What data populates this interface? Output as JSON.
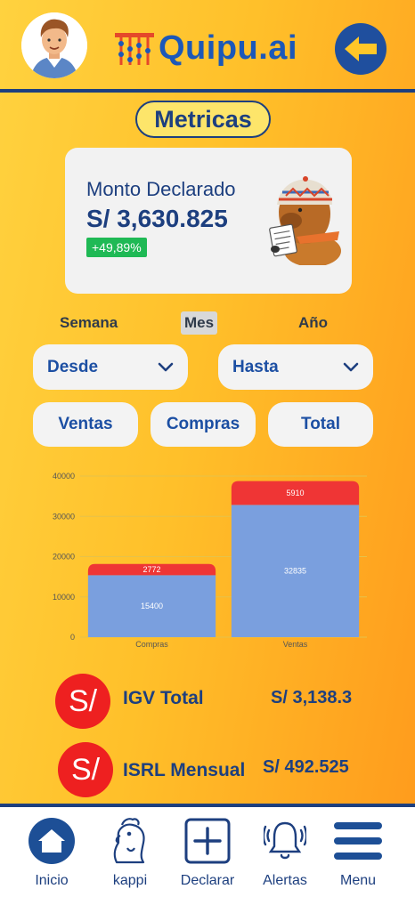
{
  "header": {
    "logo_text": "Quipu.ai",
    "avatar_icon": "user-avatar",
    "back_icon": "arrow-left-icon"
  },
  "page_title": "Metricas",
  "summary_card": {
    "label": "Monto Declarado",
    "amount": "S/ 3,630.825",
    "change": "+49,89%"
  },
  "periods": [
    "Semana",
    "Mes",
    "Año"
  ],
  "active_period": "Mes",
  "filters": {
    "from_label": "Desde",
    "to_label": "Hasta"
  },
  "segments": [
    "Ventas",
    "Compras",
    "Total"
  ],
  "chart_data": {
    "type": "bar",
    "stacked": true,
    "categories": [
      "Compras",
      "Ventas"
    ],
    "series": [
      {
        "values": [
          15400,
          32835
        ],
        "color": "#7a9fde"
      },
      {
        "values": [
          2772,
          5910
        ],
        "color": "#ef3535"
      }
    ],
    "ylim": [
      0,
      40000
    ],
    "yticks": [
      "0",
      "10000",
      "20000",
      "30000",
      "40000"
    ],
    "grid": true
  },
  "stats": [
    {
      "icon_text": "S/",
      "label": "IGV Total",
      "value": "S/ 3,138.3"
    },
    {
      "icon_text": "S/",
      "label": "ISRL Mensual",
      "value": "S/ 492.525"
    }
  ],
  "nav": [
    {
      "label": "Inicio",
      "icon": "home-icon"
    },
    {
      "label": "kappi",
      "icon": "capybara-icon"
    },
    {
      "label": "Declarar",
      "icon": "plus-square-icon"
    },
    {
      "label": "Alertas",
      "icon": "bell-icon"
    },
    {
      "label": "Menu",
      "icon": "hamburger-menu-icon"
    }
  ],
  "colors": {
    "primary": "#1d3f7f",
    "accent_blue": "#1c58b8",
    "badge_green": "#1fb955",
    "stat_red": "#ee2020"
  }
}
